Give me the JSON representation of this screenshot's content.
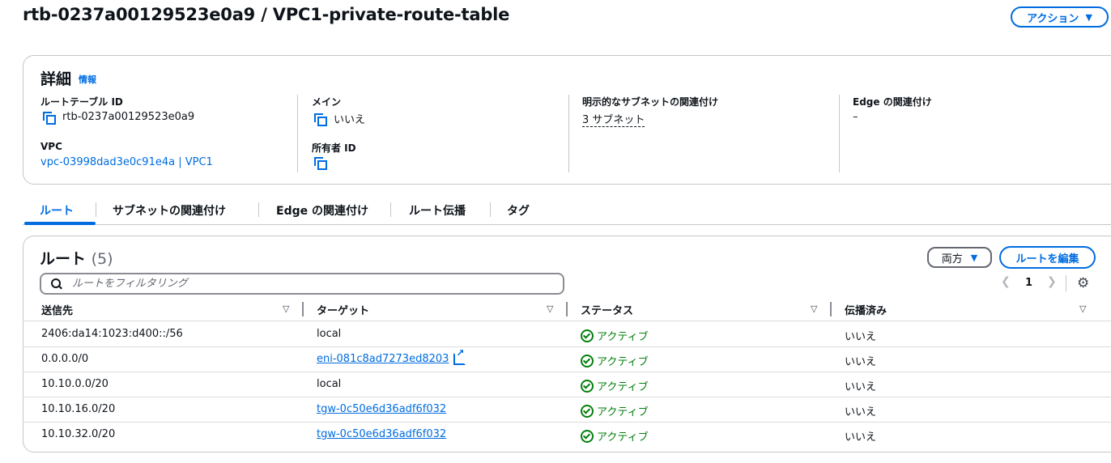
{
  "header": {
    "title": "rtb-0237a00129523e0a9 / VPC1-private-route-table",
    "actions_label": "アクション"
  },
  "details": {
    "heading": "詳細",
    "info_link": "情報",
    "route_table_id_label": "ルートテーブル ID",
    "route_table_id_value": "rtb-0237a00129523e0a9",
    "vpc_label": "VPC",
    "vpc_value": "vpc-03998dad3e0c91e4a | VPC1",
    "main_label": "メイン",
    "main_value": "いいえ",
    "owner_label": "所有者 ID",
    "explicit_subnet_label": "明示的なサブネットの関連付け",
    "explicit_subnet_value": "3 サブネット",
    "edge_label": "Edge の関連付け",
    "edge_value": "–"
  },
  "tabs": [
    {
      "label": "ルート",
      "active": true
    },
    {
      "label": "サブネットの関連付け",
      "active": false
    },
    {
      "label": "Edge の関連付け",
      "active": false
    },
    {
      "label": "ルート伝播",
      "active": false
    },
    {
      "label": "タグ",
      "active": false
    }
  ],
  "routes": {
    "heading": "ルート",
    "count": "(5)",
    "filter_select": "両方",
    "edit_button": "ルートを編集",
    "search_placeholder": "ルートをフィルタリング",
    "page": "1",
    "columns": [
      "送信先",
      "ターゲット",
      "ステータス",
      "伝播済み"
    ],
    "rows": [
      {
        "destination": "2406:da14:1023:d400::/56",
        "target": "local",
        "status": "アクティブ",
        "propagated": "いいえ"
      },
      {
        "destination": "0.0.0.0/0",
        "target": "eni-081c8ad7273ed8203",
        "status": "アクティブ",
        "propagated": "いいえ"
      },
      {
        "destination": "10.10.0.0/20",
        "target": "local",
        "status": "アクティブ",
        "propagated": "いいえ"
      },
      {
        "destination": "10.10.16.0/20",
        "target": "tgw-0c50e6d36adf6f032",
        "status": "アクティブ",
        "propagated": "いいえ"
      },
      {
        "destination": "10.10.32.0/20",
        "target": "tgw-0c50e6d36adf6f032",
        "status": "アクティブ",
        "propagated": "いいえ"
      }
    ]
  },
  "colors": {
    "accent": "#006ce0",
    "success": "#037f0c",
    "border": "#c6c6cd"
  }
}
